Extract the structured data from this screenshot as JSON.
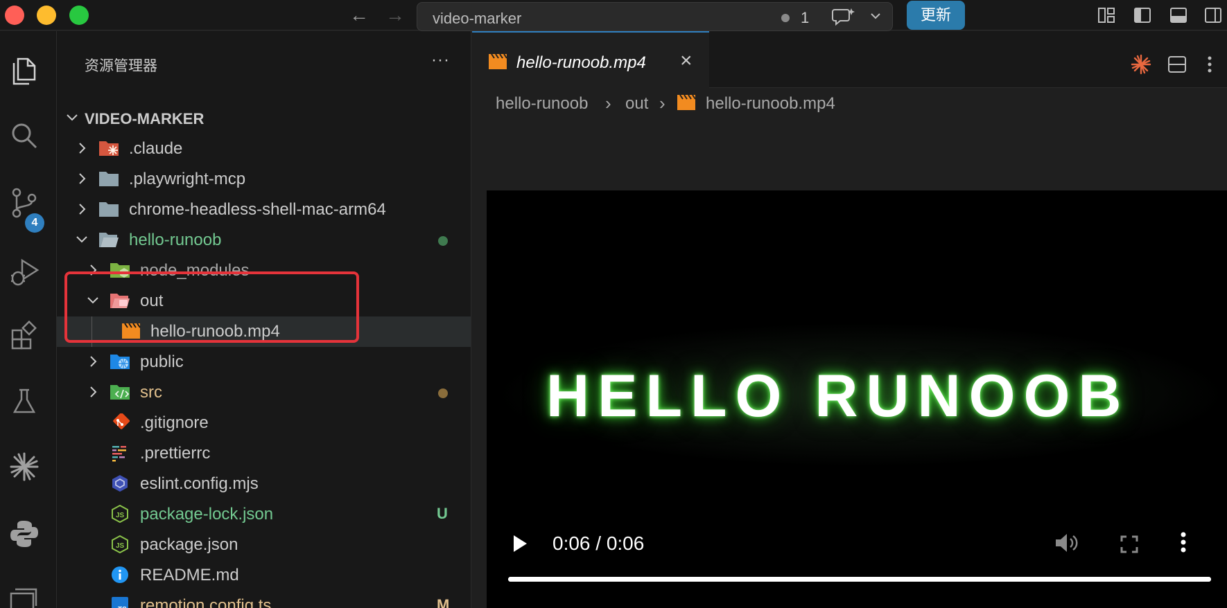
{
  "titlebar": {
    "search_title": "video-marker",
    "problem_count": "1",
    "update_label": "更新"
  },
  "activity": {
    "scm_badge": "4"
  },
  "explorer": {
    "title": "资源管理器",
    "more": "···",
    "root": "VIDEO-MARKER",
    "items": [
      {
        "label": ".claude",
        "status": ""
      },
      {
        "label": ".playwright-mcp",
        "status": ""
      },
      {
        "label": "chrome-headless-shell-mac-arm64",
        "status": ""
      },
      {
        "label": "hello-runoob",
        "status": ""
      },
      {
        "label": "node_modules",
        "status": ""
      },
      {
        "label": "out",
        "status": ""
      },
      {
        "label": "hello-runoob.mp4",
        "status": ""
      },
      {
        "label": "public",
        "status": ""
      },
      {
        "label": "src",
        "status": ""
      },
      {
        "label": ".gitignore",
        "status": ""
      },
      {
        "label": ".prettierrc",
        "status": ""
      },
      {
        "label": "eslint.config.mjs",
        "status": ""
      },
      {
        "label": "package-lock.json",
        "status": "U"
      },
      {
        "label": "package.json",
        "status": ""
      },
      {
        "label": "README.md",
        "status": ""
      },
      {
        "label": "remotion.config.ts",
        "status": "M"
      }
    ]
  },
  "editor": {
    "tab_label": "hello-runoob.mp4",
    "breadcrumb": [
      "hello-runoob",
      "out",
      "hello-runoob.mp4"
    ]
  },
  "video": {
    "frame_text": "HELLO RUNOOB",
    "time": "0:06 / 0:06",
    "progress": 1.0
  },
  "colors": {
    "accent": "#2f7fbf",
    "untracked": "#73c991",
    "modified": "#e2c08d",
    "highlight_box": "#e5333a"
  }
}
